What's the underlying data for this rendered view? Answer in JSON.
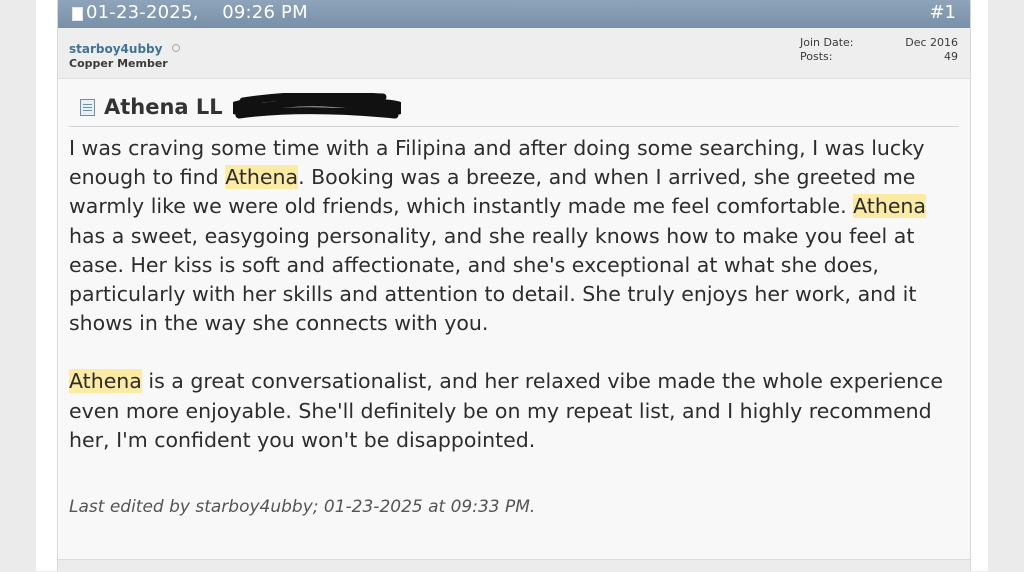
{
  "post": {
    "date": "01-23-2025,",
    "time": "09:26 PM",
    "number": "#1",
    "author": {
      "username": "starboy4ubby",
      "title": "Copper Member",
      "join_date_label": "Join Date:",
      "join_date": "Dec 2016",
      "posts_label": "Posts:",
      "posts": "49"
    },
    "title_prefix": "Athena LL",
    "paragraph1": {
      "s1": "I was craving some time with a Filipina and after doing some searching, I was lucky enough to find ",
      "hl1": "Athena",
      "s2": ". Booking was a breeze, and when I arrived, she greeted me warmly like we were old friends, which instantly made me feel comfortable. ",
      "hl2": "Athena",
      "s3": " has a sweet, easygoing personality, and she really knows how to make you feel at ease. Her kiss is soft and affectionate, and she's exceptional at what she does, particularly with her skills and attention to detail. She truly enjoys her work, and it shows in the way she connects with you."
    },
    "paragraph2": {
      "hl1": "Athena",
      "s1": " is a great conversationalist, and her relaxed vibe made the whole experience even more enjoyable. She'll definitely be on my repeat list, and I highly recommend her, I'm confident you won't be disappointed."
    },
    "edited_note": "Last edited by starboy4ubby; 01-23-2025 at 09:33 PM."
  },
  "icons": {
    "header": "document-icon",
    "title": "post-title-icon"
  },
  "colors": {
    "header_bar": "#7f97ae",
    "username": "#417394",
    "highlight": "#fbeba4"
  }
}
